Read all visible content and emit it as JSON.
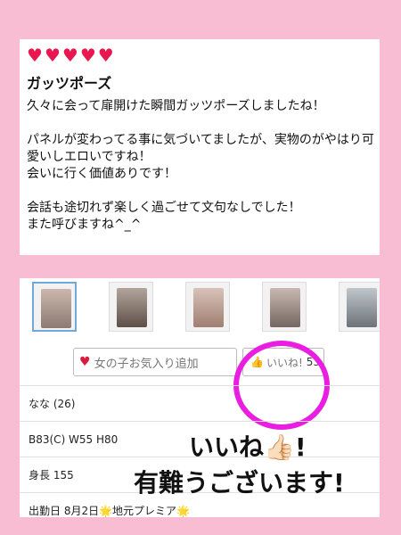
{
  "review": {
    "hearts": [
      "♥",
      "♥",
      "♥",
      "♥",
      "♥"
    ],
    "title": "ガッツポーズ",
    "body": "久々に会って扉開けた瞬間ガッツポーズしましたね！\n\nパネルが変わってる事に気づいてましたが、実物のがやはり可愛いしエロいですね！\n会いに行く価値ありです！\n\n会話も途切れず楽しく過ごせて文句なしでした！\nまた呼びますね^_^"
  },
  "gallery": {
    "thumbnails": [
      "photo-1",
      "photo-2",
      "photo-3",
      "photo-4",
      "photo-5"
    ]
  },
  "actions": {
    "favorite_label": "女の子お気入り追加",
    "like_label": "いいね!",
    "like_count": "53"
  },
  "profile": {
    "name": "なな (26)",
    "measurements": "B83(C) W55 H80",
    "height": "身長 155",
    "schedule": "出勤日 8月2日🌟地元プレミア🌟"
  },
  "overlay": {
    "line1": "いいね👍🏻!",
    "line2": "有難うございます!"
  },
  "colors": {
    "background": "#f8bdd3",
    "heart": "#e8174f",
    "circle": "#e91ee0"
  }
}
